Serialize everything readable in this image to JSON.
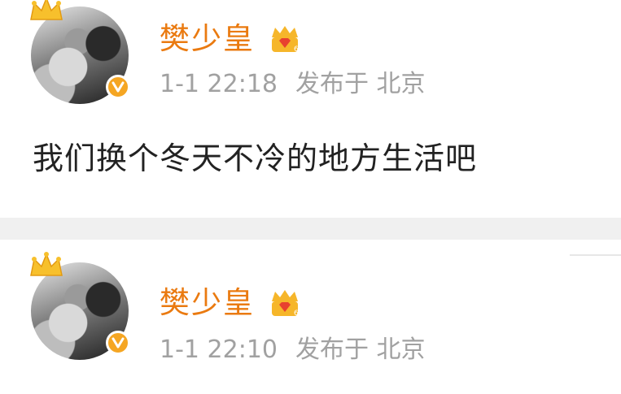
{
  "posts": [
    {
      "username": "樊少皇",
      "time": "1-1 22:18",
      "published_label": "发布于",
      "location": "北京",
      "text": "我们换个冬天不冷的地方生活吧"
    },
    {
      "username": "樊少皇",
      "time": "1-1 22:10",
      "published_label": "发布于",
      "location": "北京"
    }
  ],
  "colors": {
    "username": "#ea7a10",
    "meta": "#a1a1a1",
    "verified_badge": "#f5a623",
    "separator": "#f0f0f0"
  },
  "icons": [
    "crown-icon",
    "avatar",
    "verified-icon",
    "member-badge-icon"
  ]
}
